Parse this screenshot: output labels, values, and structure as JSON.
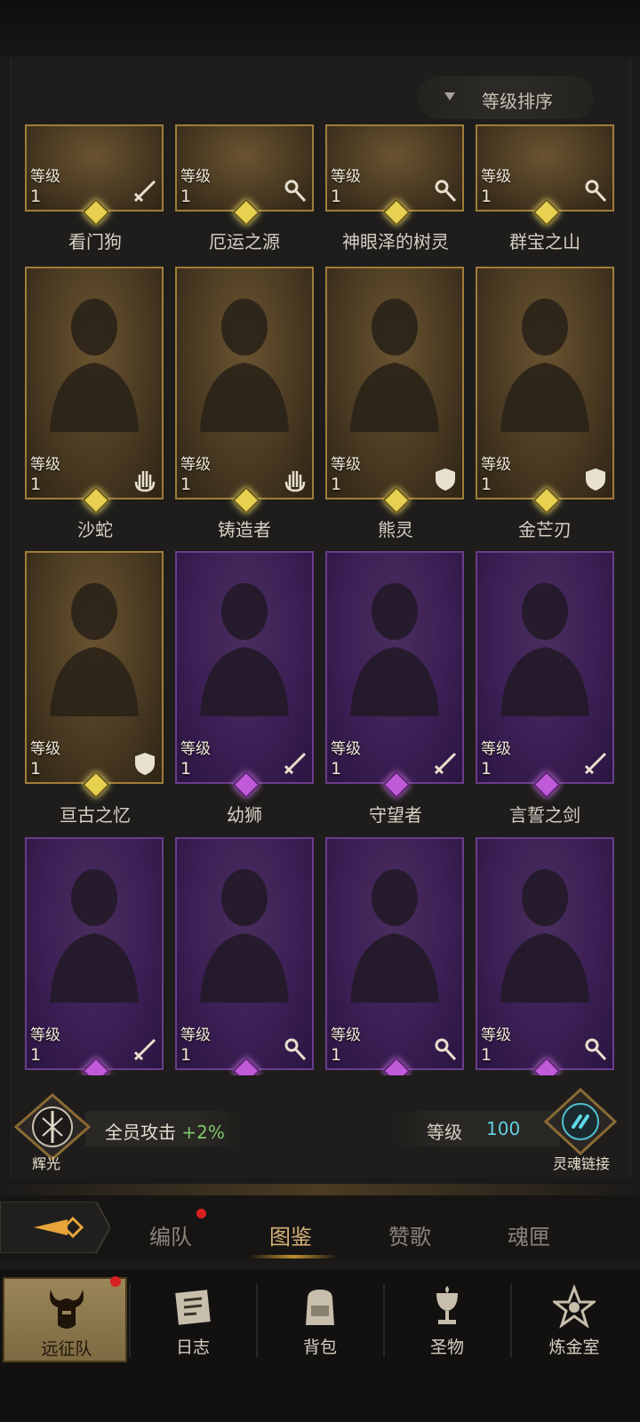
{
  "sort_button": {
    "label": "等级排序",
    "icon": "triangle-down-icon"
  },
  "level_label": "等级",
  "cards": [
    {
      "name": "看门狗",
      "level": "1",
      "rarity": "gold",
      "role_icon": "sword-icon"
    },
    {
      "name": "厄运之源",
      "level": "1",
      "rarity": "gold",
      "role_icon": "staff-icon"
    },
    {
      "name": "神眼泽的树灵",
      "level": "1",
      "rarity": "gold",
      "role_icon": "staff-icon"
    },
    {
      "name": "群宝之山",
      "level": "1",
      "rarity": "gold",
      "role_icon": "staff-icon"
    },
    {
      "name": "沙蛇",
      "level": "1",
      "rarity": "gold",
      "role_icon": "palm-icon"
    },
    {
      "name": "铸造者",
      "level": "1",
      "rarity": "gold",
      "role_icon": "palm-icon"
    },
    {
      "name": "熊灵",
      "level": "1",
      "rarity": "gold",
      "role_icon": "shield-icon"
    },
    {
      "name": "金芒刃",
      "level": "1",
      "rarity": "gold",
      "role_icon": "shield-icon"
    },
    {
      "name": "亘古之忆",
      "level": "1",
      "rarity": "gold",
      "role_icon": "shield-icon"
    },
    {
      "name": "幼狮",
      "level": "1",
      "rarity": "purple",
      "role_icon": "sword-icon"
    },
    {
      "name": "守望者",
      "level": "1",
      "rarity": "purple",
      "role_icon": "sword-icon"
    },
    {
      "name": "言誓之剑",
      "level": "1",
      "rarity": "purple",
      "role_icon": "sword-icon"
    },
    {
      "name": "",
      "level": "1",
      "rarity": "purple",
      "role_icon": "sword-icon"
    },
    {
      "name": "",
      "level": "1",
      "rarity": "purple",
      "role_icon": "staff-icon"
    },
    {
      "name": "",
      "level": "1",
      "rarity": "purple",
      "role_icon": "staff-icon"
    },
    {
      "name": "",
      "level": "1",
      "rarity": "purple",
      "role_icon": "staff-icon"
    }
  ],
  "bonus": {
    "halo_label": "辉光",
    "text": "全员攻击",
    "value": "+2%",
    "level_label": "等级",
    "level_value": "100",
    "soul_link_label": "灵魂链接"
  },
  "tabs": [
    {
      "label": "编队",
      "active": false,
      "badge": true
    },
    {
      "label": "图鉴",
      "active": true,
      "badge": false
    },
    {
      "label": "赞歌",
      "active": false,
      "badge": false
    },
    {
      "label": "魂匣",
      "active": false,
      "badge": false
    }
  ],
  "bottom_nav": [
    {
      "label": "远征队",
      "icon": "horned-helmet-icon",
      "active": true,
      "badge": true
    },
    {
      "label": "日志",
      "icon": "scroll-icon",
      "active": false,
      "badge": false
    },
    {
      "label": "背包",
      "icon": "backpack-icon",
      "active": false,
      "badge": false
    },
    {
      "label": "圣物",
      "icon": "chalice-icon",
      "active": false,
      "badge": false
    },
    {
      "label": "炼金室",
      "icon": "alchemy-icon",
      "active": false,
      "badge": false
    }
  ],
  "colors": {
    "gold_card": "#a07d3a",
    "purple_card": "#6a3d8c",
    "bonus_positive": "#7fc86a",
    "level_value": "#5fd0e0",
    "tab_active": "#d4b277",
    "badge_red": "#d82020"
  }
}
